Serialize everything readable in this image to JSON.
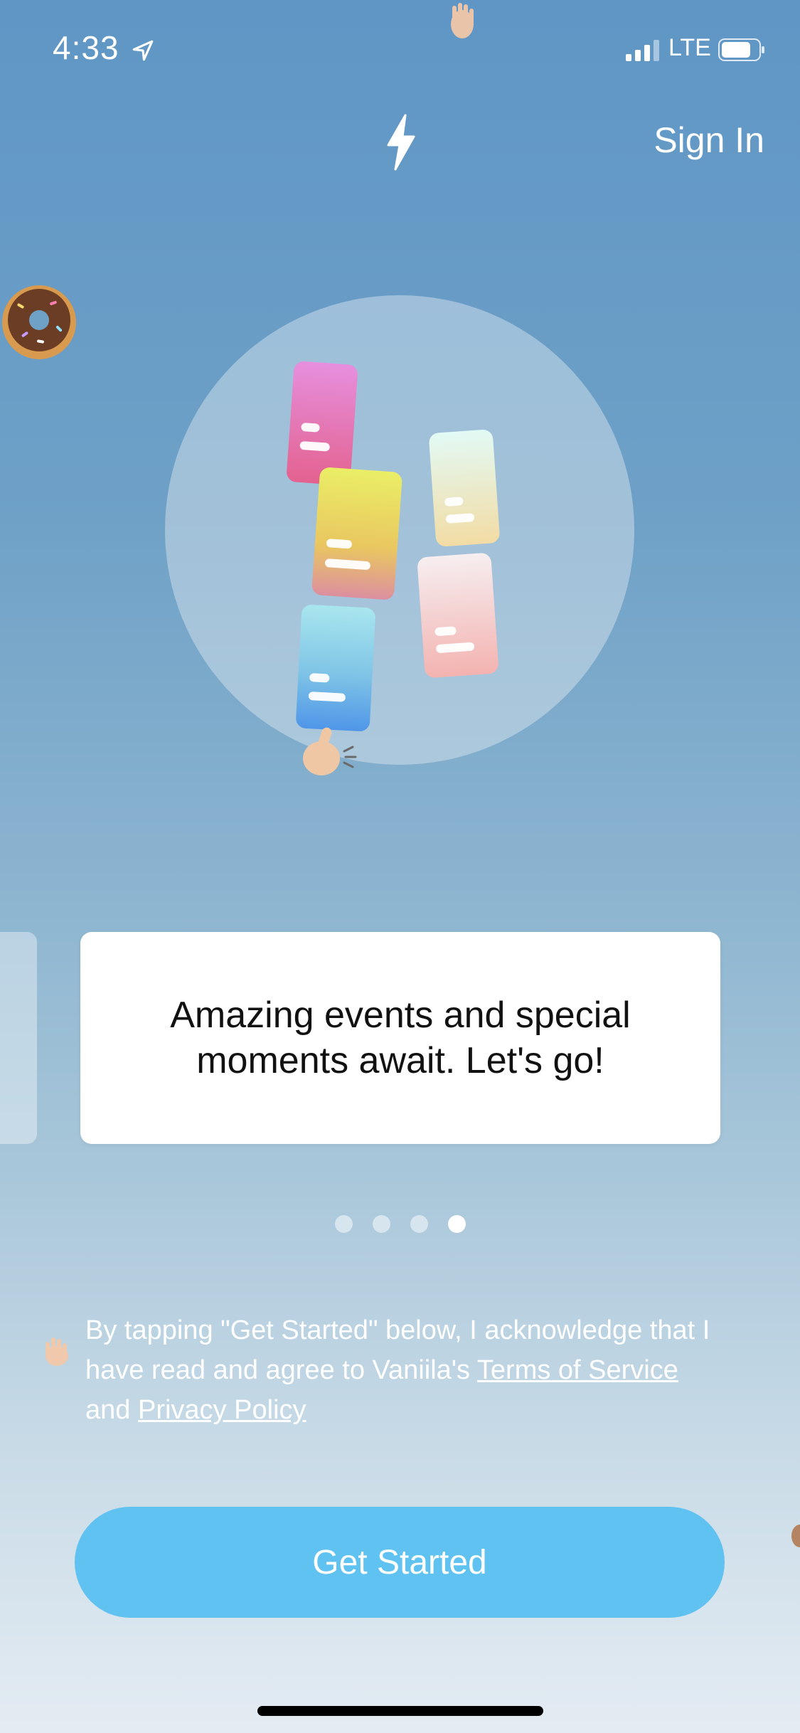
{
  "status_bar": {
    "time": "4:33",
    "network": "LTE",
    "icons": [
      "location-arrow-icon",
      "signal-icon",
      "battery-icon"
    ]
  },
  "header": {
    "sign_in_label": "Sign In",
    "logo_icon": "lightning-bolt-icon"
  },
  "carousel": {
    "text": "Amazing events and special moments await. Let's go!",
    "page_count": 4,
    "active_page": 4
  },
  "legal": {
    "prefix": "By tapping \"Get Started\" below, I acknowledge that I have read and agree to Vaniila's ",
    "terms_label": "Terms of Service",
    "middle": " and ",
    "privacy_label": "Privacy Policy"
  },
  "cta": {
    "label": "Get Started"
  },
  "colors": {
    "cta": "#5fc2f1",
    "background_top": "#5f96c5",
    "background_bottom": "#e4ecf3",
    "card": "#ffffff"
  }
}
